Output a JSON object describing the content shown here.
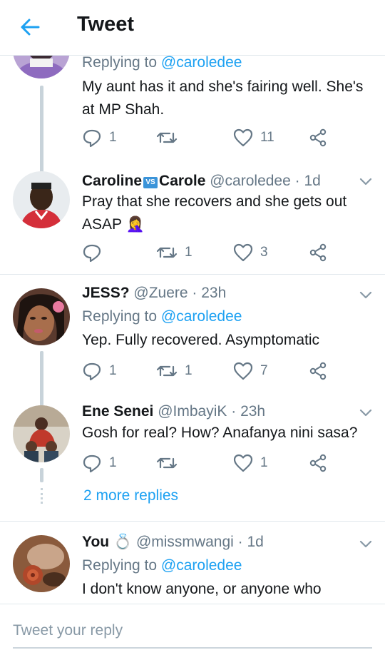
{
  "header": {
    "title": "Tweet",
    "back_icon": "arrow-left-icon",
    "accent": "#1da1f2"
  },
  "tweets": [
    {
      "reply_prefix": "Replying to",
      "reply_handle": "@caroledee",
      "text": "My aunt has it and she's fairing well. She's at MP Shah.",
      "reply_count": "1",
      "retweet_count": "",
      "like_count": "11"
    },
    {
      "name_a": "Caroline",
      "badge": "VS",
      "name_b": "Carole",
      "handle_time": "@caroledee · 1d",
      "text": "Pray that she recovers and she gets out ASAP",
      "emoji": "🤦‍♀️",
      "reply_count": "",
      "retweet_count": "1",
      "like_count": "3"
    },
    {
      "name": "JESS?",
      "handle_time": "@Zuere · 23h",
      "reply_prefix": "Replying to",
      "reply_handle": "@caroledee",
      "text": "Yep. Fully recovered. Asymptomatic",
      "reply_count": "1",
      "retweet_count": "1",
      "like_count": "7"
    },
    {
      "name": "Ene Senei",
      "handle_time": "@ImbayiK · 23h",
      "text": "Gosh for real? How? Anafanya nini sasa?",
      "reply_count": "1",
      "retweet_count": "",
      "like_count": "1"
    },
    {
      "name": "You",
      "name_emoji": "💍",
      "handle_time": "@missmwangi · 1d",
      "reply_prefix": "Replying to",
      "reply_handle": "@caroledee",
      "text": "I don't know anyone, or anyone who"
    }
  ],
  "more_replies": "2 more replies",
  "compose": {
    "placeholder": "Tweet your reply"
  }
}
